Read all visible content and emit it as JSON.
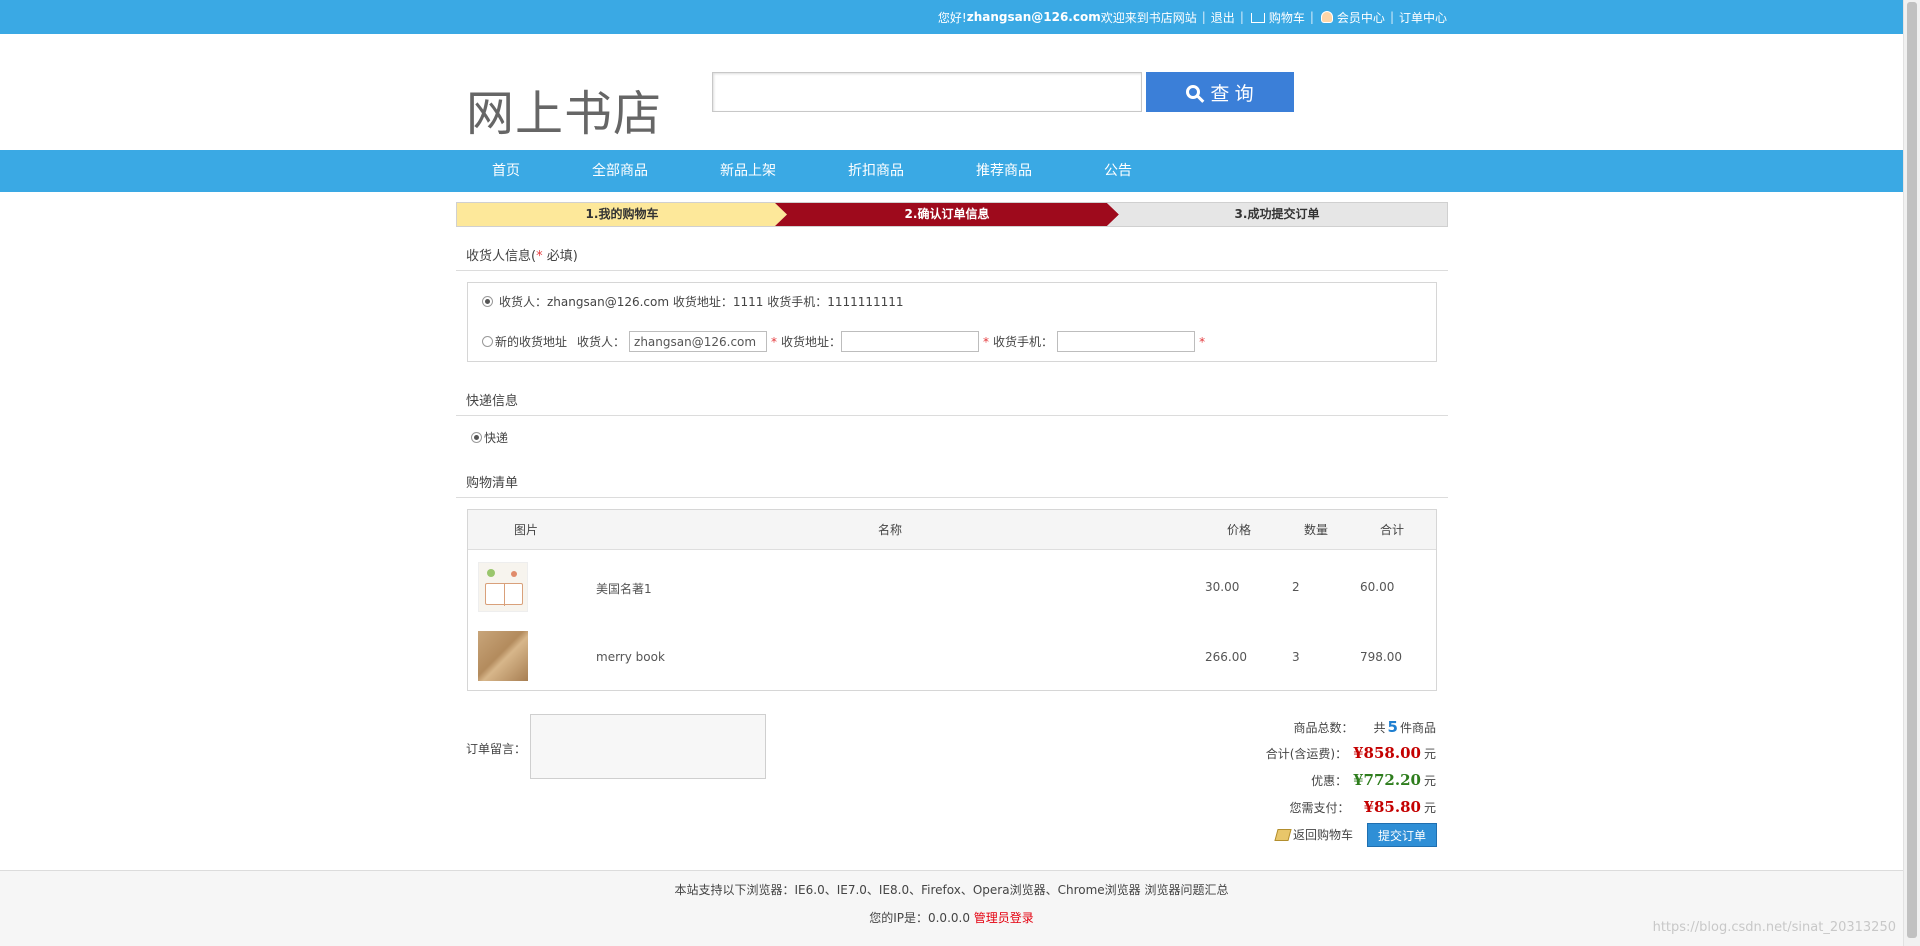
{
  "topbar": {
    "hello": "您好!",
    "user": "zhangsan@126.com",
    "welcome": "欢迎来到书店网站",
    "logout": "退出",
    "cart": "购物车",
    "member": "会员中心",
    "orders": "订单中心"
  },
  "header": {
    "logo": "网上书店",
    "search_value": "",
    "search_button": "查 询"
  },
  "nav": {
    "items": [
      "首页",
      "全部商品",
      "新品上架",
      "折扣商品",
      "推荐商品",
      "公告"
    ]
  },
  "steps": [
    "1.我的购物车",
    "2.确认订单信息",
    "3.成功提交订单"
  ],
  "receiver": {
    "title": "收货人信息(",
    "required_mark": "*",
    "required_text": " 必填)",
    "existing": "收货人：zhangsan@126.com  收货地址：1111  收货手机：1111111111",
    "new_label": "新的收货地址",
    "name_label": "收货人：",
    "name_value": "zhangsan@126.com",
    "addr_label": "收货地址：",
    "addr_value": "",
    "phone_label": "收货手机：",
    "phone_value": "",
    "star": "*"
  },
  "delivery": {
    "title": "快递信息",
    "option": "快递"
  },
  "cart": {
    "title": "购物清单",
    "columns": [
      "图片",
      "名称",
      "价格",
      "数量",
      "合计"
    ],
    "rows": [
      {
        "name": "美国名著1",
        "price": "30.00",
        "qty": "2",
        "total": "60.00"
      },
      {
        "name": "merry book",
        "price": "266.00",
        "qty": "3",
        "total": "798.00"
      }
    ]
  },
  "summary": {
    "note_label": "订单留言：",
    "count_label": "商品总数：",
    "count_prefix": "共",
    "count_value": "5",
    "count_suffix": "件商品",
    "total_label": "合计(含运费)：",
    "total_value": "¥858.00",
    "discount_label": "优惠：",
    "discount_value": "¥772.20",
    "pay_label": "您需支付：",
    "pay_value": "¥85.80",
    "unit": "元",
    "back": "返回购物车",
    "submit": "提交订单"
  },
  "footer": {
    "browsers": "本站支持以下浏览器：IE6.0、IE7.0、IE8.0、Firefox、Opera浏览器、Chrome浏览器 浏览器问题汇总",
    "ip_text": "您的IP是：0.0.0.0 ",
    "admin_login": "管理员登录",
    "watermark": "https://blog.csdn.net/sinat_20313250"
  },
  "colors": {
    "brand_blue": "#3aa9e4",
    "step_active": "#9e0a1c",
    "price_red": "#c40000",
    "discount_green": "#2e7d1d"
  }
}
